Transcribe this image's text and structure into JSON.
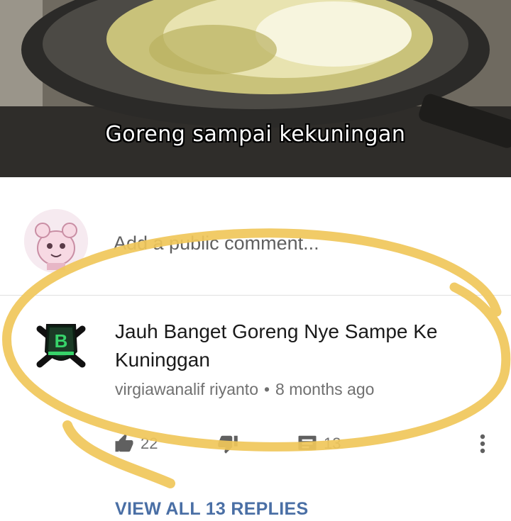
{
  "video": {
    "caption": "Goreng sampai kekuningan"
  },
  "add_comment": {
    "placeholder": "Add a public comment..."
  },
  "comment": {
    "text": "Jauh Banget Goreng Nye Sampe Ke Kuninggan",
    "author": "virgiawanalif riyanto",
    "separator": "•",
    "time": "8 months ago",
    "likes": "22",
    "replies": "13",
    "avatar_letter": "B"
  },
  "view_replies": "VIEW ALL 13 REPLIES",
  "colors": {
    "link": "#4a6fa5",
    "marker": "#f0c75a"
  }
}
